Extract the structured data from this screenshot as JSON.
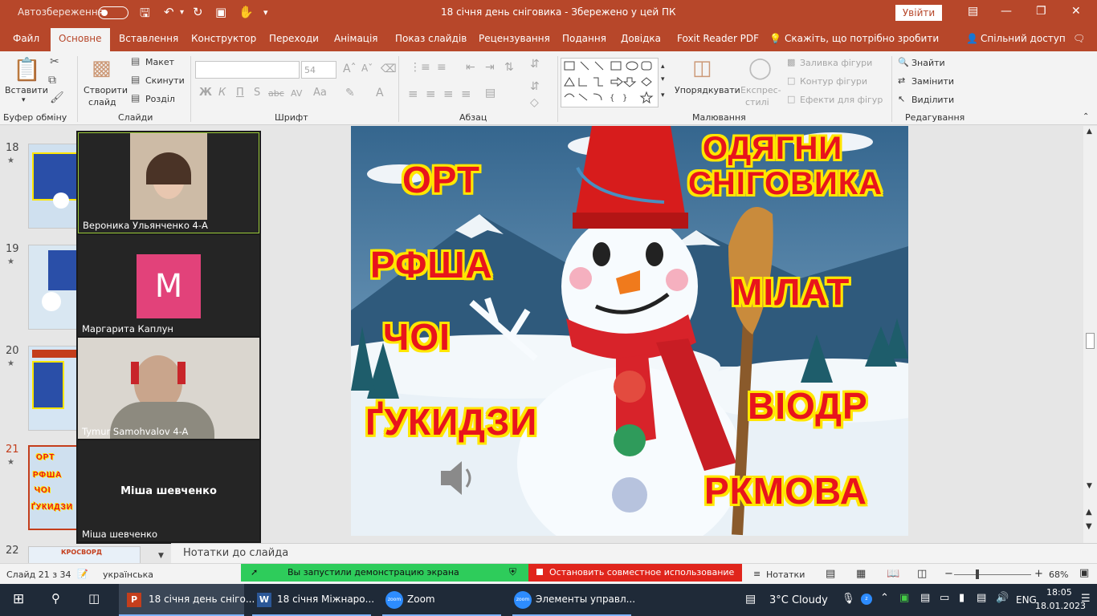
{
  "titlebar": {
    "autosave_label": "Автозбереження",
    "title": "18 січня день сніговика  -  Збережено у цей ПК",
    "signin": "Увійти"
  },
  "menu": [
    "Файл",
    "Основне",
    "Вставлення",
    "Конструктор",
    "Переходи",
    "Анімація",
    "Показ слайдів",
    "Рецензування",
    "Подання",
    "Довідка",
    "Foxit Reader PDF",
    "Скажіть, що потрібно зробити",
    "Спільний доступ"
  ],
  "ribbon": {
    "paste": "Вставити",
    "clipboard_group": "Буфер обміну",
    "new_slide_line1": "Створити",
    "new_slide_line2": "слайд",
    "layout": "Макет",
    "reset": "Скинути",
    "section": "Розділ",
    "slides_group": "Слайди",
    "font_size": "54",
    "font_group": "Шрифт",
    "paragraph_group": "Абзац",
    "arrange": "Упорядкувати",
    "quick_styles_line1": "Експрес-",
    "quick_styles_line2": "стилі",
    "shape_fill": "Заливка фігури",
    "shape_outline": "Контур фігури",
    "shape_effects": "Ефекти для фігур",
    "drawing_group": "Малювання",
    "find": "Знайти",
    "replace": "Замінити",
    "select": "Виділити",
    "editing_group": "Редагування",
    "bold": "Ж",
    "italic": "К",
    "underline": "П",
    "strike": "abc",
    "spacing": "AV",
    "case": "Aa"
  },
  "thumbnails": [
    {
      "num": "18"
    },
    {
      "num": "19"
    },
    {
      "num": "20"
    },
    {
      "num": "21",
      "selected": true,
      "words": [
        "ОРТ",
        "РФША",
        "ЧОІ",
        "ҐУКИДЗИ"
      ]
    },
    {
      "num": "22",
      "title": "КРОСВОРД"
    }
  ],
  "zoom_participants": [
    {
      "name": "Вероника Ульянченко 4-А",
      "type": "video"
    },
    {
      "name": "Маргарита Каплун",
      "type": "avatar",
      "initial": "М"
    },
    {
      "name": "Tymur Samohvalov 4-A",
      "type": "video"
    },
    {
      "name": "Міша шевченко",
      "type": "name",
      "center_label": "Міша шевченко"
    }
  ],
  "slide": {
    "heading_line1": "ОДЯГНИ",
    "heading_line2": "СНІГОВИКА",
    "words": [
      "ОРТ",
      "РФША",
      "ЧОІ",
      "ҐУКИДЗИ",
      "МІЛАТ",
      "ВІОДР",
      "РКМОВА"
    ]
  },
  "notes_placeholder": "Нотатки до слайда",
  "status": {
    "slide_counter": "Слайд 21 з 34",
    "language": "українська",
    "notes_button": "Нотатки",
    "zoom_level": "68%"
  },
  "zoom_banner": {
    "sharing_text": "Вы запустили демонстрацию экрана",
    "stop_text": "Остановить совместное использование"
  },
  "taskbar": {
    "apps": [
      {
        "label": "18 січня день сніго...",
        "active": true
      },
      {
        "label": "18 січня  Міжнаро..."
      },
      {
        "label": "Zoom"
      },
      {
        "label": "Элементы управл..."
      }
    ],
    "weather": "3°C  Cloudy",
    "lang": "ENG",
    "time": "18:05",
    "date": "18.01.2023"
  },
  "colors": {
    "accent": "#b7472a",
    "zoom_green": "#2ecc5b",
    "zoom_red": "#e0251c",
    "slide_word": "#e8141c",
    "word_outline": "#ffe600"
  }
}
